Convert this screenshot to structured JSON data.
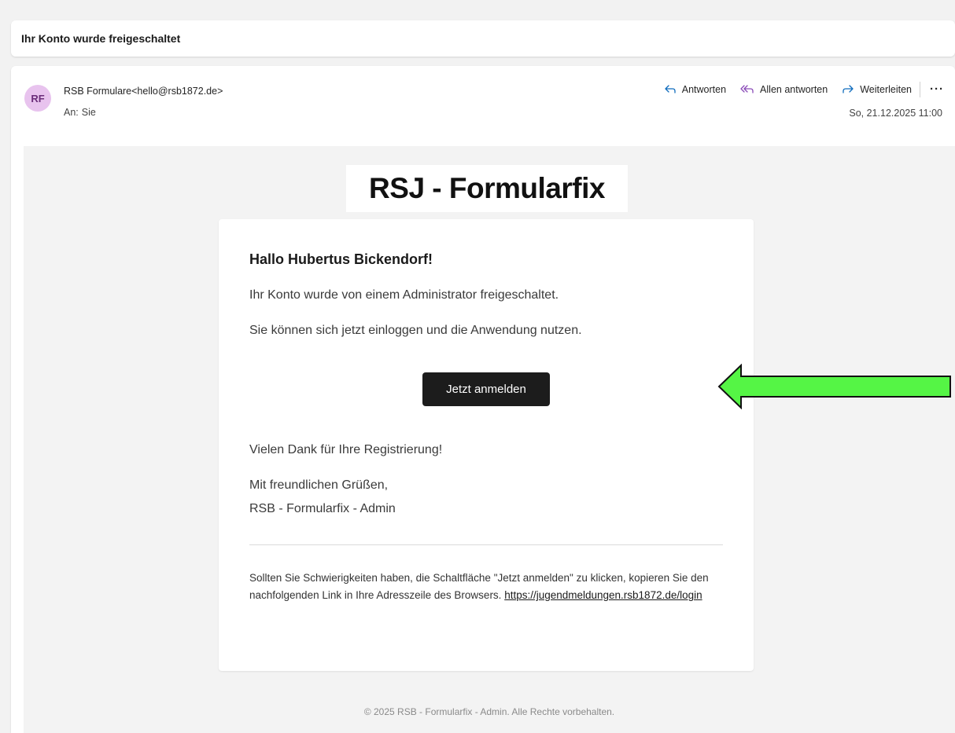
{
  "subject": "Ihr Konto wurde freigeschaltet",
  "header": {
    "avatar_initials": "RF",
    "sender": "RSB Formulare<hello@rsb1872.de>",
    "to_label": "An:",
    "to_value": "Sie",
    "date": "So, 21.12.2025 11:00",
    "actions": {
      "reply": "Antworten",
      "reply_all": "Allen antworten",
      "forward": "Weiterleiten",
      "more": "···"
    }
  },
  "body": {
    "logo": "RSJ - Formularfix",
    "greeting": "Hallo Hubertus Bickendorf!",
    "line1": "Ihr Konto wurde von einem Administrator freigeschaltet.",
    "line2": "Sie können sich jetzt einloggen und die Anwendung nutzen.",
    "button": "Jetzt anmelden",
    "thanks": "Vielen Dank für Ihre Registrierung!",
    "closing": "Mit freundlichen Grüßen,",
    "signature": "RSB - Formularfix - Admin",
    "footnote": "Sollten Sie Schwierigkeiten haben, die Schaltfläche \"Jetzt anmelden\" zu klicken, kopieren Sie den nachfolgenden Link in Ihre Adresszeile des Browsers. ",
    "link": "https://jugendmeldungen.rsb1872.de/login",
    "copyright": "© 2025 RSB - Formularfix - Admin. Alle Rechte vorbehalten."
  },
  "colors": {
    "arrow_fill": "#55f545",
    "button_bg": "#1c1c1c",
    "avatar_bg": "#e8c3ee",
    "action_icon": "#0f6cbd"
  },
  "icons": {
    "reply": "reply-icon",
    "reply_all": "reply-all-icon",
    "forward": "forward-icon",
    "more": "more-icon"
  }
}
